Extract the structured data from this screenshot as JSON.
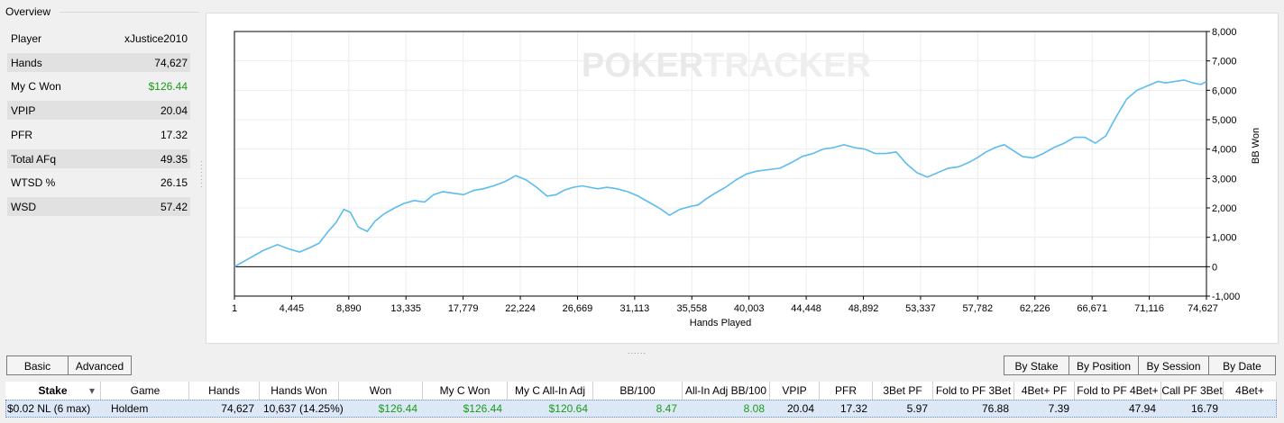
{
  "overview": {
    "title": "Overview",
    "stats": [
      {
        "label": "Player",
        "value": "xJustice2010",
        "green": false
      },
      {
        "label": "Hands",
        "value": "74,627",
        "green": false
      },
      {
        "label": "My C Won",
        "value": "$126.44",
        "green": true
      },
      {
        "label": "VPIP",
        "value": "20.04",
        "green": false
      },
      {
        "label": "PFR",
        "value": "17.32",
        "green": false
      },
      {
        "label": "Total AFq",
        "value": "49.35",
        "green": false
      },
      {
        "label": "WTSD %",
        "value": "26.15",
        "green": false
      },
      {
        "label": "WSD",
        "value": "57.42",
        "green": false
      }
    ]
  },
  "chart_data": {
    "type": "line",
    "watermark": "POKERTRACKER",
    "xlabel": "Hands Played",
    "ylabel": "BB Won",
    "x_ticks": [
      "1",
      "4,445",
      "8,890",
      "13,335",
      "17,779",
      "22,224",
      "26,669",
      "31,113",
      "35,558",
      "40,003",
      "44,448",
      "48,892",
      "53,337",
      "57,782",
      "62,226",
      "66,671",
      "71,116",
      "74,627"
    ],
    "y_ticks": [
      "8,000",
      "7,000",
      "6,000",
      "5,000",
      "4,000",
      "3,000",
      "2,000",
      "1,000",
      "0",
      "-1,000"
    ],
    "xlim": [
      1,
      74627
    ],
    "ylim": [
      -1000,
      8000
    ],
    "line_color": "#5bbcef",
    "series": [
      {
        "x": [
          1,
          1000,
          2200,
          3300,
          4200,
          5000,
          5800,
          6500,
          7200,
          7800,
          8400,
          8900,
          9500,
          10200,
          10800,
          11500,
          12300,
          13000,
          13800,
          14600,
          15300,
          16000,
          16800,
          17600,
          18400,
          19100,
          19900,
          20800,
          21600,
          22400,
          23200,
          24000,
          24700,
          25300,
          26000,
          26700,
          27300,
          27900,
          28600,
          29400,
          30200,
          31000,
          31800,
          32600,
          33400,
          34200,
          35000,
          35600,
          36200,
          36900,
          37700,
          38500,
          39300,
          40100,
          41000,
          41900,
          42800,
          43600,
          44400,
          45200,
          46000,
          46800,
          47600,
          48400,
          49200,
          50000,
          50800,
          51600,
          52400,
          53200,
          54000,
          54800,
          55600,
          56400,
          57000,
          57700,
          58400,
          59100,
          59800,
          60500,
          61300,
          62100,
          62900,
          63700,
          64500,
          65300,
          66100,
          66900,
          67700,
          68500,
          69300,
          70100,
          70900,
          71500,
          72200,
          72900,
          73600,
          74200,
          74627
        ],
        "y": [
          0,
          250,
          550,
          750,
          600,
          500,
          650,
          800,
          1200,
          1500,
          1950,
          1850,
          1350,
          1200,
          1550,
          1800,
          2000,
          2150,
          2250,
          2200,
          2450,
          2550,
          2500,
          2450,
          2600,
          2650,
          2750,
          2900,
          3100,
          2950,
          2700,
          2400,
          2450,
          2600,
          2700,
          2750,
          2700,
          2650,
          2700,
          2650,
          2550,
          2400,
          2200,
          2000,
          1750,
          1950,
          2050,
          2100,
          2300,
          2500,
          2700,
          2950,
          3150,
          3250,
          3300,
          3350,
          3550,
          3750,
          3850,
          4000,
          4050,
          4150,
          4050,
          4000,
          3850,
          3850,
          3900,
          3500,
          3200,
          3050,
          3200,
          3350,
          3400,
          3550,
          3700,
          3900,
          4050,
          4150,
          3950,
          3750,
          3700,
          3850,
          4050,
          4200,
          4400,
          4400,
          4200,
          4450,
          5100,
          5700,
          6000,
          6150,
          6300,
          6250,
          6300,
          6350,
          6250,
          6200,
          6300
        ]
      }
    ]
  },
  "toolbar": {
    "view_buttons": [
      "Basic",
      "Advanced"
    ],
    "group_buttons": [
      "By Stake",
      "By Position",
      "By Session",
      "By Date"
    ]
  },
  "table": {
    "columns": [
      "Stake",
      "Game",
      "Hands",
      "Hands Won",
      "Won",
      "My C Won",
      "My C All-In Adj",
      "BB/100",
      "All-In Adj BB/100",
      "VPIP",
      "PFR",
      "3Bet PF",
      "Fold to PF 3Bet",
      "4Bet+ PF",
      "Fold to PF 4Bet+",
      "Call PF 3Bet",
      "4Bet+"
    ],
    "sort_indicator": "▾",
    "rows": [
      {
        "stake": "$0.02 NL (6 max)",
        "game": "Holdem",
        "hands": "74,627",
        "hands_won": "10,637 (14.25%)",
        "won": "$126.44",
        "my_c_won": "$126.44",
        "my_c_allin_adj": "$120.64",
        "bb100": "8.47",
        "allin_adj_bb100": "8.08",
        "vpip": "20.04",
        "pfr": "17.32",
        "threebet_pf": "5.97",
        "fold_to_pf_3bet": "76.88",
        "fourbet_pf": "7.39",
        "fold_to_pf_4bet": "47.94",
        "call_pf_3bet": "16.79",
        "fourbet_plus": ""
      }
    ]
  },
  "colors": {
    "green_value": "#1a9a1a",
    "row_selected": "#dde8f7",
    "line": "#5bbcef"
  }
}
